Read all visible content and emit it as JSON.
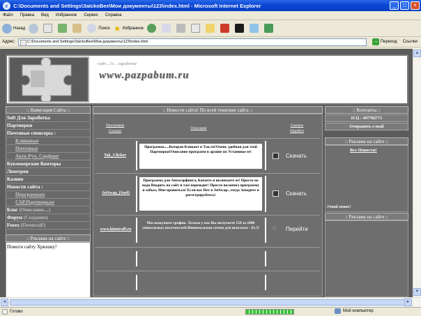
{
  "window": {
    "title": "C:\\Documents and Settings\\ЗаIckoBee\\Мои документы\\123\\index.html - Microsoft Internet Explorer"
  },
  "menu": [
    "Файл",
    "Правка",
    "Вид",
    "Избранное",
    "Сервис",
    "Справка"
  ],
  "toolbar": {
    "back": "Назад",
    "search": "Поиск",
    "favorites": "Избранное"
  },
  "address": {
    "label": "Адрес:",
    "value": "C:\\Documents and Settings\\ЗаIckoBee\\Мои документы\\123\\index.html",
    "go": "Переход",
    "links": "Ссылки"
  },
  "page": {
    "tagline": "сайт... О... заработке",
    "logo": "www.pazpabum.ru",
    "left": {
      "header": ":: Навигация Сайта ::",
      "nav": [
        {
          "label": "Soft Для Заработка",
          "sub": false
        },
        {
          "label": "Партнерки",
          "sub": false
        },
        {
          "label": "Почтовые спонсоры :",
          "sub": false
        },
        {
          "label": "Кликовые",
          "sub": true
        },
        {
          "label": "Почтовые",
          "sub": true
        },
        {
          "label": "Авто-Руч. Серфинг",
          "sub": true
        },
        {
          "label": "Букмекерские Конторы",
          "sub": false
        },
        {
          "label": "Лохотрон",
          "sub": false
        },
        {
          "label": "Казино",
          "sub": false
        },
        {
          "label": "Новости сайта :",
          "sub": false
        },
        {
          "label": "Программам",
          "sub": true
        },
        {
          "label": "САР.Партнеркам",
          "sub": true
        }
      ],
      "blog_label": "Блог",
      "blog_extra": "(Описания....)",
      "forum_label": "Форум",
      "forum_extra": "(Создание)",
      "forex_label": "Forex",
      "forex_extra": "(Почитай!)",
      "ads_header": ":: Реклама на сайте ::",
      "ads_text": "Помоги сайту Хрюшку!"
    },
    "center": {
      "header": ":: Новости сайта! По всей тематике сайта ::",
      "col_program": "Программа",
      "col_links": "Ссылки",
      "col_desc": "Описание",
      "col_download": "Скачать",
      "col_go": "Перейти",
      "rows": [
        {
          "name": "Tak_Clicker",
          "desc": "Программа.....Которая Кликает в Так.ru!Очень удобная для этой Партнерки!Описание программ в архиве по Установке ее!",
          "action": "Скачать"
        },
        {
          "name": "JetSwap_(Surf)",
          "desc": "Программа для Автосерфинга, Качаете и включаете ее! Просто не надо Входить на сайт и там переходит! Просто включил программу и забыл, Мне нравиться! Если вас Нет в JetSwap...тогда Заходите и регестрируйтесь!",
          "action": "Скачать"
        },
        {
          "name": "www.kinotraff.ru",
          "desc": "Мы выкупаем трафик .Только у нас Вы получаете 15$ за 1000 уникальных посетителей.Минимальная сумма для выплаты - $1.5!",
          "action": "Перейти",
          "marker": "::::"
        }
      ]
    },
    "right": {
      "contacts_header": ":: Контакты ::",
      "icq": "ICQ : 497782771",
      "email": "Отправить e-mail",
      "ads_header": ":: Реклама на сайте ::",
      "all_news": "Все Новости!",
      "new_label": "Узнай новое!",
      "ads_header2": ":: Реклама на сайте ::"
    }
  },
  "status": {
    "text": "Готово",
    "zone": "Мой компьютер"
  }
}
